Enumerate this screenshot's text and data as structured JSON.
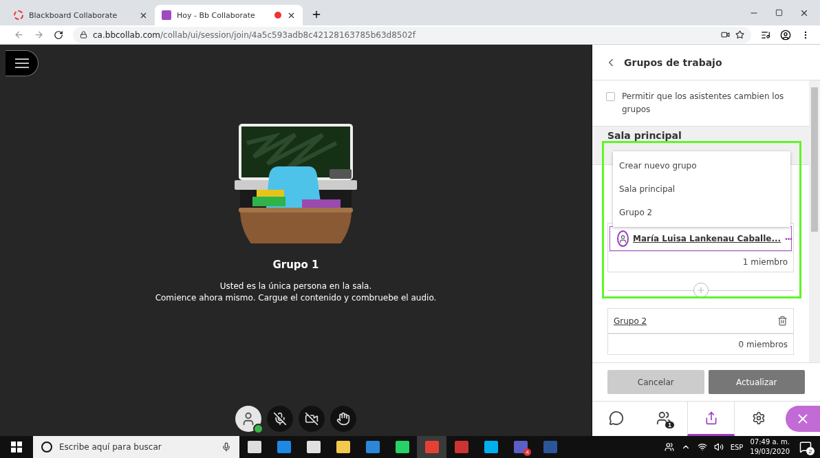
{
  "browser": {
    "tabs": [
      {
        "title": "Blackboard Collaborate",
        "selected": false,
        "recording": false
      },
      {
        "title": "Hoy - Bb Collaborate",
        "selected": true,
        "recording": true
      }
    ],
    "url_host": "ca.bbcollab.com",
    "url_path": "/collab/ui/session/join/4a5c593adb8c42128163785b63d8502f"
  },
  "stage": {
    "room_title": "Grupo 1",
    "message_lines": [
      "Usted es la única persona en la sala.",
      "Comience ahora mismo. Cargue el contenido y combruebe el audio."
    ],
    "presence_ok": true,
    "mic_muted": true,
    "camera_off": true
  },
  "panel": {
    "title": "Grupos de trabajo",
    "allow_switch": {
      "label": "Permitir que los asistentes cambien los grupos",
      "checked": false
    },
    "main_room_title": "Sala principal",
    "move_menu": [
      "Crear nuevo grupo",
      "Sala principal",
      "Grupo 2"
    ],
    "groups": [
      {
        "members": [
          {
            "name": "María Luisa Lankenau Caballe...",
            "more": "•••"
          }
        ],
        "count": "1 miembro"
      },
      {
        "name": "Grupo 2",
        "count": "0 miembros"
      }
    ],
    "buttons": [
      {
        "label": "Cancelar",
        "kind": "secondary"
      },
      {
        "label": "Actualizar",
        "kind": "primary"
      }
    ],
    "nav": [
      {
        "kind": "chat",
        "selected": false
      },
      {
        "kind": "people",
        "selected": false,
        "badge": "1"
      },
      {
        "kind": "share",
        "selected": true
      },
      {
        "kind": "settings",
        "selected": false
      }
    ]
  },
  "taskbar": {
    "search_placeholder": "Escribe aquí para buscar",
    "teams_badge": "4",
    "language": "ESP",
    "time": "07:49 a. m.",
    "date": "19/03/2020",
    "notifications": "2"
  }
}
